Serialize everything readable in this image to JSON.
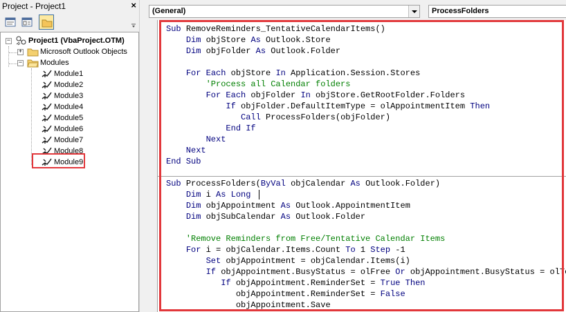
{
  "project_pane": {
    "title": "Project - Project1",
    "close_glyph": "×",
    "tree": {
      "root": "Project1 (VbaProject.OTM)",
      "outlook_objects": "Microsoft Outlook Objects",
      "modules_folder": "Modules",
      "modules": [
        "Module1",
        "Module2",
        "Module3",
        "Module4",
        "Module5",
        "Module6",
        "Module7",
        "Module8",
        "Module9"
      ]
    }
  },
  "code_window": {
    "object_combo": "(General)",
    "procedure_combo": "ProcessFolders",
    "lines": [
      "Sub RemoveReminders_TentativeCalendarItems()",
      "    Dim objStore As Outlook.Store",
      "    Dim objFolder As Outlook.Folder",
      "",
      "    For Each objStore In Application.Session.Stores",
      "        'Process all Calendar folders",
      "        For Each objFolder In objStore.GetRootFolder.Folders",
      "            If objFolder.DefaultItemType = olAppointmentItem Then",
      "               Call ProcessFolders(objFolder)",
      "            End If",
      "        Next",
      "    Next",
      "End Sub",
      "",
      "Sub ProcessFolders(ByVal objCalendar As Outlook.Folder)",
      "    Dim i As Long",
      "    Dim objAppointment As Outlook.AppointmentItem",
      "    Dim objSubCalendar As Outlook.Folder",
      "",
      "    'Remove Reminders from Free/Tentative Calendar Items",
      "    For i = objCalendar.Items.Count To 1 Step -1",
      "        Set objAppointment = objCalendar.Items(i)",
      "        If objAppointment.BusyStatus = olFree Or objAppointment.BusyStatus = olTentative Then",
      "           If objAppointment.ReminderSet = True Then",
      "              objAppointment.ReminderSet = False",
      "              objAppointment.Save"
    ]
  },
  "colors": {
    "keyword": "#00007f",
    "comment": "#007f00",
    "highlight": "#e2373b"
  },
  "icons": {
    "toolbar": [
      "view-code-icon",
      "view-object-icon",
      "toggle-folders-icon"
    ],
    "tree": [
      "project-icon",
      "folder-icon",
      "module-icon"
    ]
  }
}
